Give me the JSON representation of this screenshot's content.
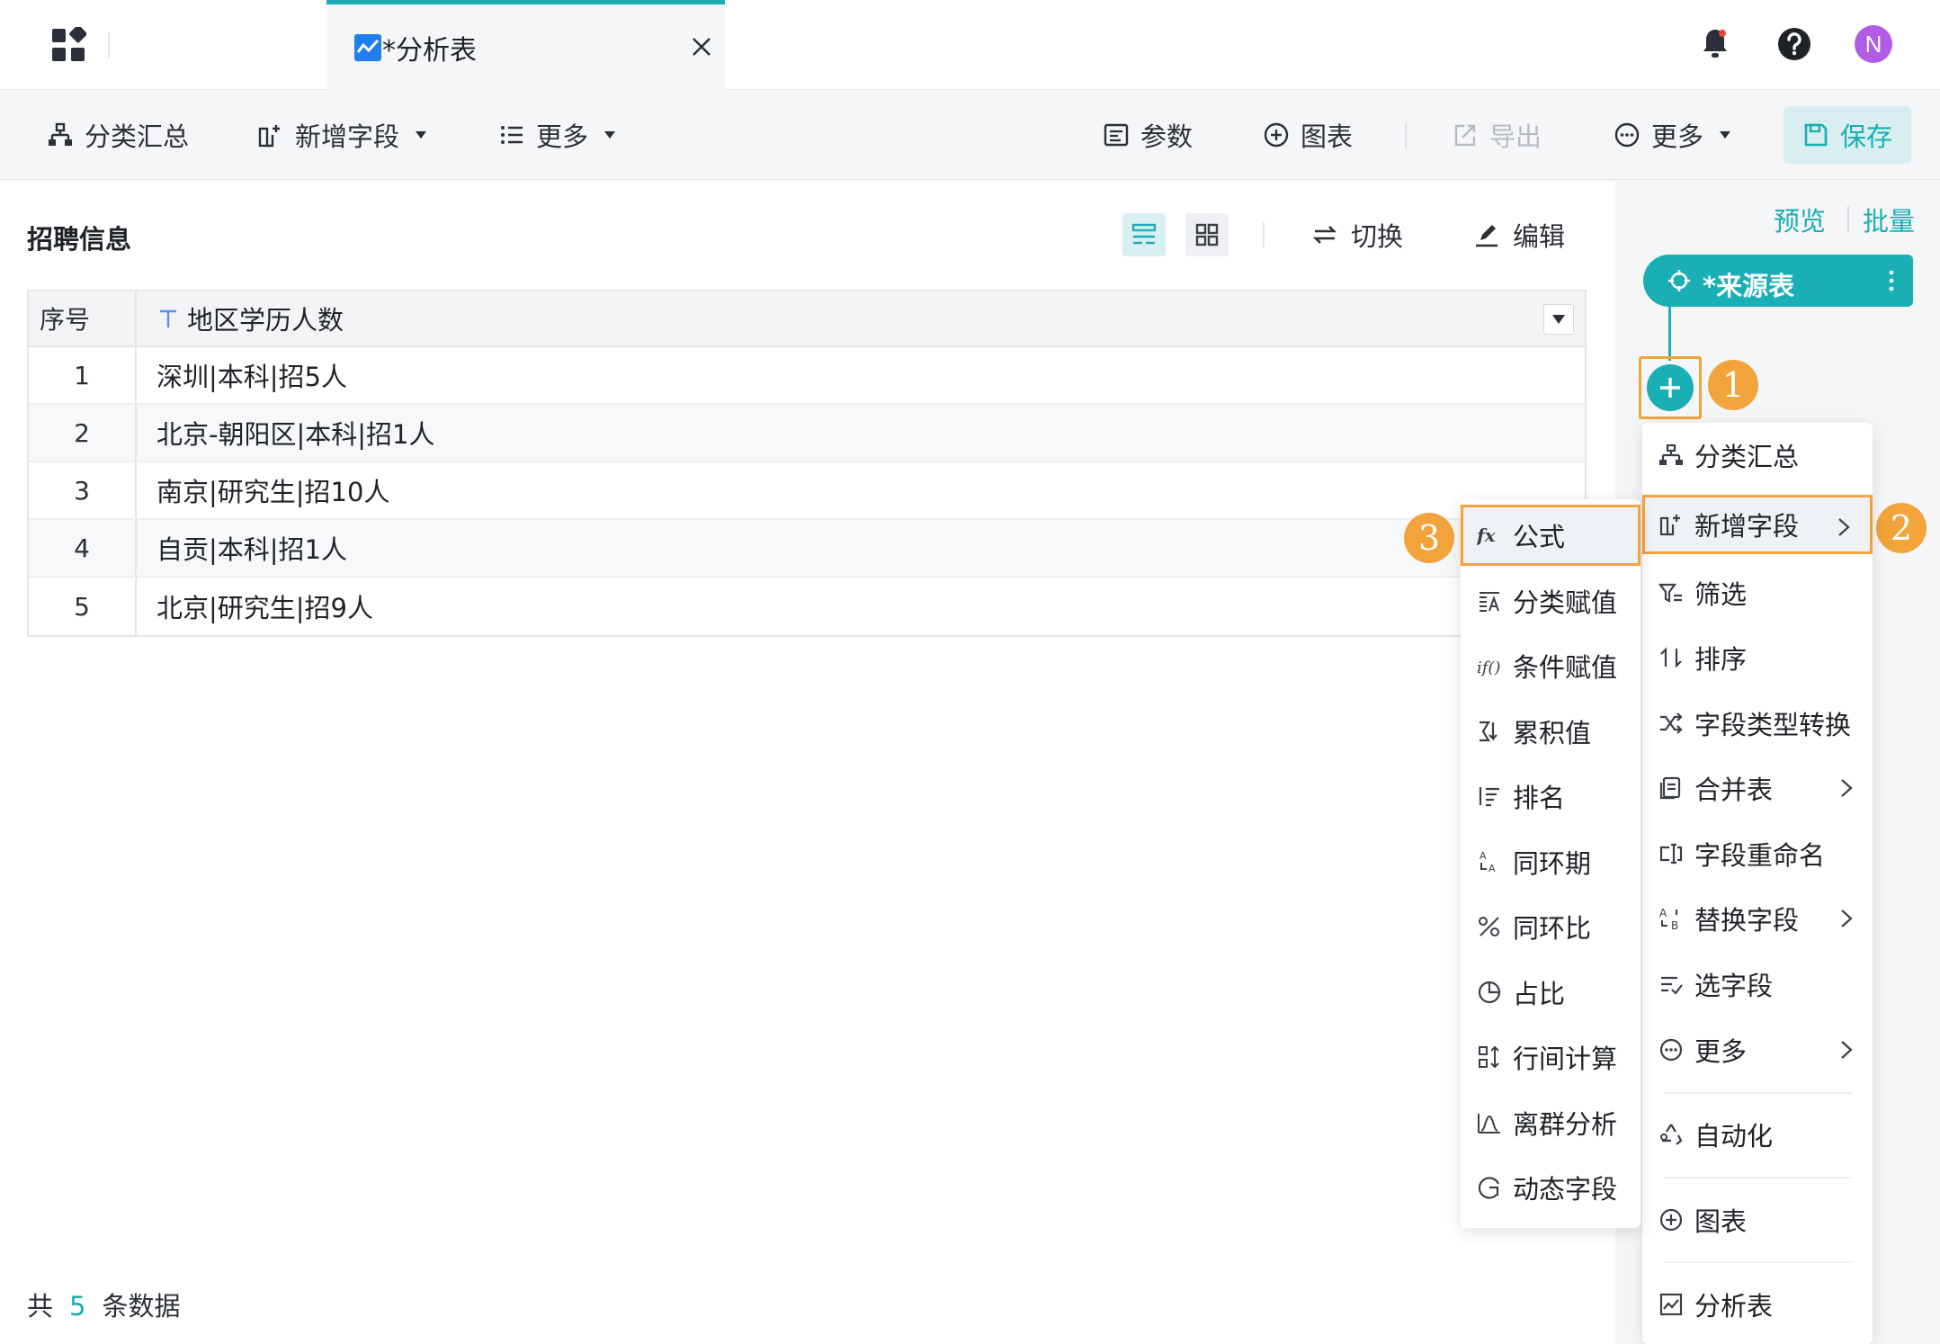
{
  "tab": {
    "title": "*分析表",
    "close": "×"
  },
  "header": {
    "avatar_initial": "N"
  },
  "toolbar": {
    "group_summary": "分类汇总",
    "add_field": "新增字段",
    "more_left": "更多",
    "params": "参数",
    "chart": "图表",
    "export": "导出",
    "more_right": "更多",
    "save": "保存"
  },
  "panel": {
    "title": "招聘信息",
    "switch": "切换",
    "edit": "编辑"
  },
  "table": {
    "headers": [
      "序号",
      "地区学历人数"
    ],
    "rows": [
      {
        "index": "1",
        "value": "深圳|本科|招5人"
      },
      {
        "index": "2",
        "value": "北京-朝阳区|本科|招1人"
      },
      {
        "index": "3",
        "value": "南京|研究生|招10人"
      },
      {
        "index": "4",
        "value": "自贡|本科|招1人"
      },
      {
        "index": "5",
        "value": "北京|研究生|招9人"
      }
    ]
  },
  "footer": {
    "prefix": "共",
    "count": "5",
    "suffix": "条数据"
  },
  "side": {
    "preview": "预览",
    "batch": "批量",
    "source_node": "*来源表"
  },
  "steps": [
    "1",
    "2",
    "3"
  ],
  "menu_main": [
    {
      "label": "分类汇总",
      "icon": "group-summary-icon"
    },
    {
      "label": "新增字段",
      "icon": "add-field-icon",
      "submenu": true,
      "active": true
    },
    {
      "label": "筛选",
      "icon": "filter-icon"
    },
    {
      "label": "排序",
      "icon": "sort-icon"
    },
    {
      "label": "字段类型转换",
      "icon": "shuffle-icon"
    },
    {
      "label": "合并表",
      "icon": "merge-table-icon",
      "submenu": true
    },
    {
      "label": "字段重命名",
      "icon": "rename-icon"
    },
    {
      "label": "替换字段",
      "icon": "replace-icon",
      "submenu": true
    },
    {
      "label": "选字段",
      "icon": "select-field-icon"
    },
    {
      "label": "更多",
      "icon": "more-icon",
      "submenu": true
    },
    {
      "label": "自动化",
      "icon": "automation-icon"
    },
    {
      "label": "图表",
      "icon": "chart-plus-icon"
    },
    {
      "label": "分析表",
      "icon": "analysis-table-icon"
    }
  ],
  "menu_sub": [
    {
      "label": "公式",
      "icon": "formula-icon",
      "active": true
    },
    {
      "label": "分类赋值",
      "icon": "category-assign-icon"
    },
    {
      "label": "条件赋值",
      "icon": "condition-assign-icon"
    },
    {
      "label": "累积值",
      "icon": "cumulative-icon"
    },
    {
      "label": "排名",
      "icon": "ranking-icon"
    },
    {
      "label": "同环期",
      "icon": "period-icon"
    },
    {
      "label": "同环比",
      "icon": "ratio-icon"
    },
    {
      "label": "占比",
      "icon": "proportion-icon"
    },
    {
      "label": "行间计算",
      "icon": "row-calc-icon"
    },
    {
      "label": "离群分析",
      "icon": "outlier-icon"
    },
    {
      "label": "动态字段",
      "icon": "dynamic-field-icon"
    }
  ],
  "colors": {
    "accent": "#1aaeb5",
    "step": "#f2a43c",
    "avatar": "#b05ce6"
  }
}
